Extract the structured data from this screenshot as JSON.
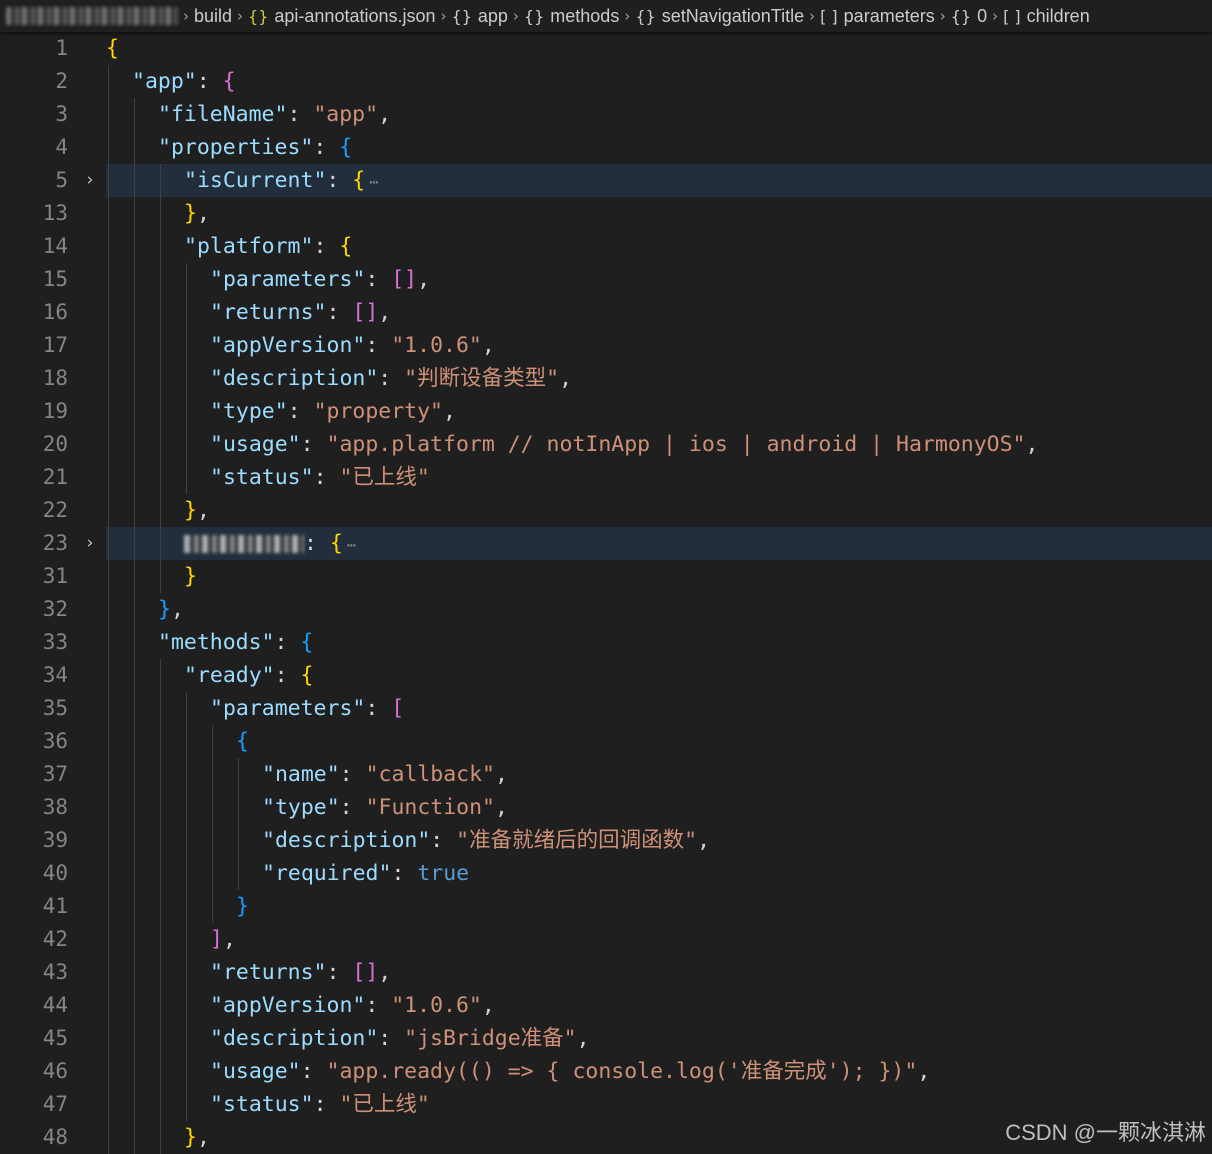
{
  "breadcrumb": [
    {
      "label": "build",
      "icon": "folder-icon",
      "symbol": ""
    },
    {
      "label": "api-annotations.json",
      "icon": "json-file-icon",
      "symbol": "{}"
    },
    {
      "label": "app",
      "icon": "object-icon",
      "symbol": "{}"
    },
    {
      "label": "methods",
      "icon": "object-icon",
      "symbol": "{}"
    },
    {
      "label": "setNavigationTitle",
      "icon": "object-icon",
      "symbol": "{}"
    },
    {
      "label": "parameters",
      "icon": "array-icon",
      "symbol": "[ ]"
    },
    {
      "label": "0",
      "icon": "object-icon",
      "symbol": "{}"
    },
    {
      "label": "children",
      "icon": "array-icon",
      "symbol": "[ ]"
    }
  ],
  "colors": {
    "background": "#1f1f1f",
    "key": "#9cdcfe",
    "string": "#ce9178",
    "bracket_level1": "#ffd700",
    "bracket_level2": "#da70d6",
    "bracket_level3": "#179fff",
    "keyword": "#569cd6",
    "line_number": "#858585"
  },
  "editor": {
    "lines": [
      {
        "num": "1",
        "indent": 0,
        "tokens": [
          {
            "t": "{",
            "c": "b1"
          }
        ]
      },
      {
        "num": "2",
        "indent": 1,
        "tokens": [
          {
            "t": "\"app\"",
            "c": "k"
          },
          {
            "t": ": ",
            "c": "p"
          },
          {
            "t": "{",
            "c": "b2"
          }
        ]
      },
      {
        "num": "3",
        "indent": 2,
        "tokens": [
          {
            "t": "\"fileName\"",
            "c": "k"
          },
          {
            "t": ": ",
            "c": "p"
          },
          {
            "t": "\"app\"",
            "c": "s"
          },
          {
            "t": ",",
            "c": "p"
          }
        ]
      },
      {
        "num": "4",
        "indent": 2,
        "tokens": [
          {
            "t": "\"properties\"",
            "c": "k"
          },
          {
            "t": ": ",
            "c": "p"
          },
          {
            "t": "{",
            "c": "b3"
          }
        ]
      },
      {
        "num": "5",
        "indent": 3,
        "fold": true,
        "highlight": true,
        "tokens": [
          {
            "t": "\"isCurrent\"",
            "c": "k"
          },
          {
            "t": ": ",
            "c": "p"
          },
          {
            "t": "{",
            "c": "b1"
          },
          {
            "t": "⋯",
            "c": "ell"
          }
        ]
      },
      {
        "num": "13",
        "indent": 3,
        "tokens": [
          {
            "t": "}",
            "c": "b1"
          },
          {
            "t": ",",
            "c": "p"
          }
        ]
      },
      {
        "num": "14",
        "indent": 3,
        "tokens": [
          {
            "t": "\"platform\"",
            "c": "k"
          },
          {
            "t": ": ",
            "c": "p"
          },
          {
            "t": "{",
            "c": "b1"
          }
        ]
      },
      {
        "num": "15",
        "indent": 4,
        "tokens": [
          {
            "t": "\"parameters\"",
            "c": "k"
          },
          {
            "t": ": ",
            "c": "p"
          },
          {
            "t": "[]",
            "c": "b2"
          },
          {
            "t": ",",
            "c": "p"
          }
        ]
      },
      {
        "num": "16",
        "indent": 4,
        "tokens": [
          {
            "t": "\"returns\"",
            "c": "k"
          },
          {
            "t": ": ",
            "c": "p"
          },
          {
            "t": "[]",
            "c": "b2"
          },
          {
            "t": ",",
            "c": "p"
          }
        ]
      },
      {
        "num": "17",
        "indent": 4,
        "tokens": [
          {
            "t": "\"appVersion\"",
            "c": "k"
          },
          {
            "t": ": ",
            "c": "p"
          },
          {
            "t": "\"1.0.6\"",
            "c": "s"
          },
          {
            "t": ",",
            "c": "p"
          }
        ]
      },
      {
        "num": "18",
        "indent": 4,
        "tokens": [
          {
            "t": "\"description\"",
            "c": "k"
          },
          {
            "t": ": ",
            "c": "p"
          },
          {
            "t": "\"判断设备类型\"",
            "c": "s"
          },
          {
            "t": ",",
            "c": "p"
          }
        ]
      },
      {
        "num": "19",
        "indent": 4,
        "tokens": [
          {
            "t": "\"type\"",
            "c": "k"
          },
          {
            "t": ": ",
            "c": "p"
          },
          {
            "t": "\"property\"",
            "c": "s"
          },
          {
            "t": ",",
            "c": "p"
          }
        ]
      },
      {
        "num": "20",
        "indent": 4,
        "tokens": [
          {
            "t": "\"usage\"",
            "c": "k"
          },
          {
            "t": ": ",
            "c": "p"
          },
          {
            "t": "\"app.platform // notInApp | ios | android | HarmonyOS\"",
            "c": "s"
          },
          {
            "t": ",",
            "c": "p"
          }
        ]
      },
      {
        "num": "21",
        "indent": 4,
        "tokens": [
          {
            "t": "\"status\"",
            "c": "k"
          },
          {
            "t": ": ",
            "c": "p"
          },
          {
            "t": "\"已上线\"",
            "c": "s"
          }
        ]
      },
      {
        "num": "22",
        "indent": 3,
        "tokens": [
          {
            "t": "}",
            "c": "b1"
          },
          {
            "t": ",",
            "c": "p"
          }
        ]
      },
      {
        "num": "23",
        "indent": 3,
        "fold": true,
        "highlight": true,
        "blurred": true,
        "tokens": [
          {
            "t": ": ",
            "c": "p"
          },
          {
            "t": "{",
            "c": "b1"
          },
          {
            "t": "⋯",
            "c": "ell"
          }
        ]
      },
      {
        "num": "31",
        "indent": 3,
        "tokens": [
          {
            "t": "}",
            "c": "b1"
          }
        ]
      },
      {
        "num": "32",
        "indent": 2,
        "tokens": [
          {
            "t": "}",
            "c": "b3"
          },
          {
            "t": ",",
            "c": "p"
          }
        ]
      },
      {
        "num": "33",
        "indent": 2,
        "tokens": [
          {
            "t": "\"methods\"",
            "c": "k"
          },
          {
            "t": ": ",
            "c": "p"
          },
          {
            "t": "{",
            "c": "b3"
          }
        ]
      },
      {
        "num": "34",
        "indent": 3,
        "tokens": [
          {
            "t": "\"ready\"",
            "c": "k"
          },
          {
            "t": ": ",
            "c": "p"
          },
          {
            "t": "{",
            "c": "b1"
          }
        ]
      },
      {
        "num": "35",
        "indent": 4,
        "tokens": [
          {
            "t": "\"parameters\"",
            "c": "k"
          },
          {
            "t": ": ",
            "c": "p"
          },
          {
            "t": "[",
            "c": "b2"
          }
        ]
      },
      {
        "num": "36",
        "indent": 5,
        "tokens": [
          {
            "t": "{",
            "c": "b3"
          }
        ]
      },
      {
        "num": "37",
        "indent": 6,
        "tokens": [
          {
            "t": "\"name\"",
            "c": "k"
          },
          {
            "t": ": ",
            "c": "p"
          },
          {
            "t": "\"callback\"",
            "c": "s"
          },
          {
            "t": ",",
            "c": "p"
          }
        ]
      },
      {
        "num": "38",
        "indent": 6,
        "tokens": [
          {
            "t": "\"type\"",
            "c": "k"
          },
          {
            "t": ": ",
            "c": "p"
          },
          {
            "t": "\"Function\"",
            "c": "s"
          },
          {
            "t": ",",
            "c": "p"
          }
        ]
      },
      {
        "num": "39",
        "indent": 6,
        "tokens": [
          {
            "t": "\"description\"",
            "c": "k"
          },
          {
            "t": ": ",
            "c": "p"
          },
          {
            "t": "\"准备就绪后的回调函数\"",
            "c": "s"
          },
          {
            "t": ",",
            "c": "p"
          }
        ]
      },
      {
        "num": "40",
        "indent": 6,
        "tokens": [
          {
            "t": "\"required\"",
            "c": "k"
          },
          {
            "t": ": ",
            "c": "p"
          },
          {
            "t": "true",
            "c": "kw"
          }
        ]
      },
      {
        "num": "41",
        "indent": 5,
        "tokens": [
          {
            "t": "}",
            "c": "b3"
          }
        ]
      },
      {
        "num": "42",
        "indent": 4,
        "tokens": [
          {
            "t": "]",
            "c": "b2"
          },
          {
            "t": ",",
            "c": "p"
          }
        ]
      },
      {
        "num": "43",
        "indent": 4,
        "tokens": [
          {
            "t": "\"returns\"",
            "c": "k"
          },
          {
            "t": ": ",
            "c": "p"
          },
          {
            "t": "[]",
            "c": "b2"
          },
          {
            "t": ",",
            "c": "p"
          }
        ]
      },
      {
        "num": "44",
        "indent": 4,
        "tokens": [
          {
            "t": "\"appVersion\"",
            "c": "k"
          },
          {
            "t": ": ",
            "c": "p"
          },
          {
            "t": "\"1.0.6\"",
            "c": "s"
          },
          {
            "t": ",",
            "c": "p"
          }
        ]
      },
      {
        "num": "45",
        "indent": 4,
        "tokens": [
          {
            "t": "\"description\"",
            "c": "k"
          },
          {
            "t": ": ",
            "c": "p"
          },
          {
            "t": "\"jsBridge准备\"",
            "c": "s"
          },
          {
            "t": ",",
            "c": "p"
          }
        ]
      },
      {
        "num": "46",
        "indent": 4,
        "tokens": [
          {
            "t": "\"usage\"",
            "c": "k"
          },
          {
            "t": ": ",
            "c": "p"
          },
          {
            "t": "\"app.ready(() => { console.log('准备完成'); })\"",
            "c": "s"
          },
          {
            "t": ",",
            "c": "p"
          }
        ]
      },
      {
        "num": "47",
        "indent": 4,
        "tokens": [
          {
            "t": "\"status\"",
            "c": "k"
          },
          {
            "t": ": ",
            "c": "p"
          },
          {
            "t": "\"已上线\"",
            "c": "s"
          }
        ]
      },
      {
        "num": "48",
        "indent": 3,
        "tokens": [
          {
            "t": "}",
            "c": "b1"
          },
          {
            "t": ",",
            "c": "p"
          }
        ]
      }
    ]
  },
  "watermark": "CSDN @一颗冰淇淋"
}
